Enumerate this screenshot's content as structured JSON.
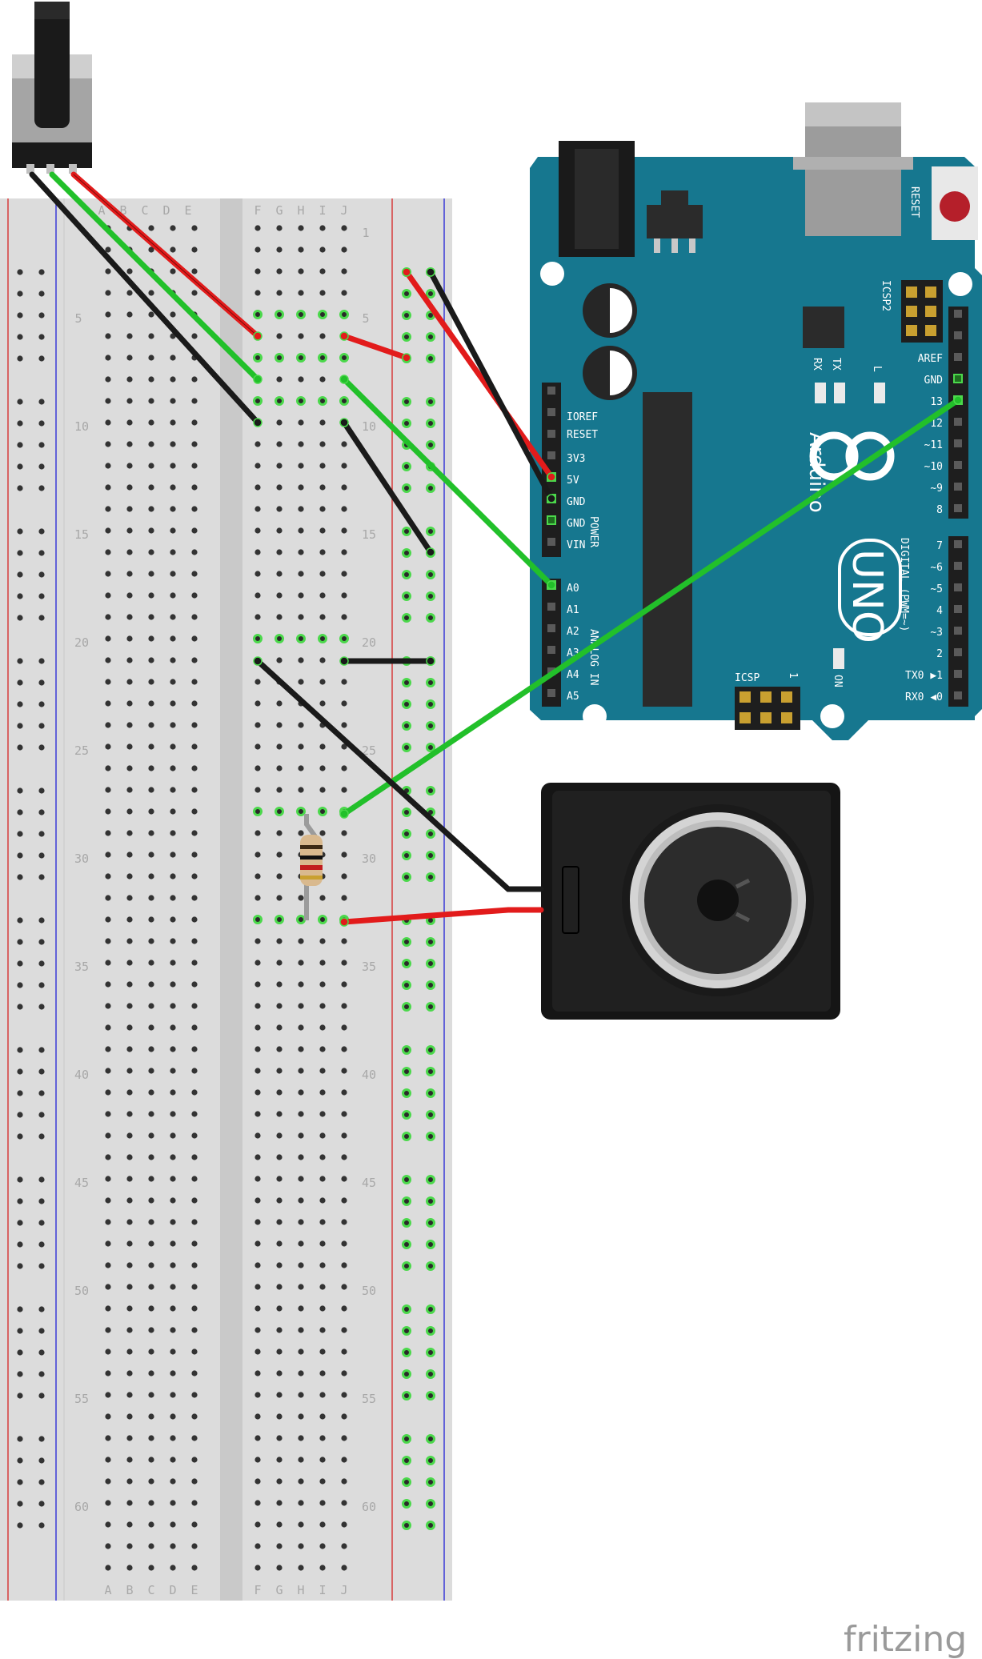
{
  "breadboard": {
    "column_letters_left": [
      "A",
      "B",
      "C",
      "D",
      "E"
    ],
    "column_letters_right": [
      "F",
      "G",
      "H",
      "I",
      "J"
    ],
    "row_numbers": [
      "1",
      "5",
      "10",
      "15",
      "20",
      "25",
      "30",
      "35",
      "40",
      "45",
      "50",
      "55",
      "60"
    ]
  },
  "arduino": {
    "name": "Arduino",
    "model": "UNO",
    "reset_label": "RESET",
    "icsp_label": "ICSP",
    "icsp2_label": "ICSP2",
    "icsp_pin1": "1",
    "tx_label": "TX",
    "rx_label": "RX",
    "l_label": "L",
    "on_label": "ON",
    "power_header_label": "POWER",
    "analog_header_label": "ANALOG IN",
    "digital_header_label": "DIGITAL (PWM=~)",
    "power_pins": [
      "IOREF",
      "RESET",
      "3V3",
      "5V",
      "GND",
      "GND",
      "VIN"
    ],
    "analog_pins": [
      "A0",
      "A1",
      "A2",
      "A3",
      "A4",
      "A5"
    ],
    "digital_top_pins": [
      "AREF",
      "GND",
      "13",
      "12",
      "~11",
      "~10",
      "~9",
      "8"
    ],
    "digital_bottom_pins": [
      "7",
      "~6",
      "~5",
      "4",
      "~3",
      "2",
      "TX0 ▶1",
      "RX0 ◀0"
    ]
  },
  "components": [
    "potentiometer",
    "resistor",
    "speaker"
  ],
  "wire_colors": {
    "red": "#e21b1b",
    "black": "#1a1a1a",
    "green": "#22c02a"
  },
  "board_color": "#16778f",
  "footer": {
    "brand": "fritzing"
  }
}
